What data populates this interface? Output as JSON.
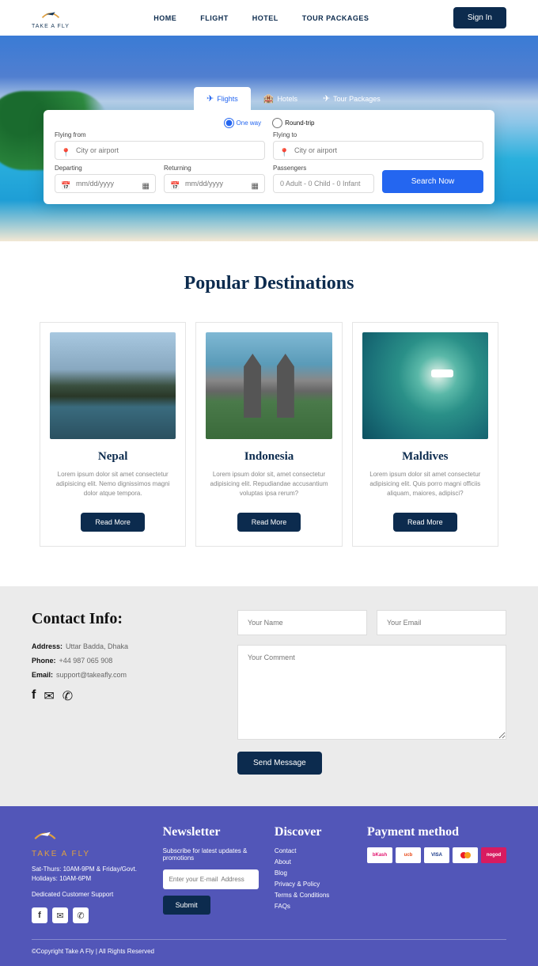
{
  "brand": "TAKE A FLY",
  "nav": {
    "home": "HOME",
    "flight": "FLIGHT",
    "hotel": "HOTEL",
    "tours": "TOUR PACKAGES"
  },
  "signin": "Sign In",
  "tabs": {
    "flights": "Flights",
    "hotels": "Hotels",
    "tours": "Tour Packages"
  },
  "trip": {
    "oneway": "One way",
    "roundtrip": "Round-trip"
  },
  "search": {
    "from_label": "Flying from",
    "to_label": "Flying to",
    "city_ph": "City or airport",
    "depart_label": "Departing",
    "return_label": "Returning",
    "date_ph": "mm/dd/yyyy",
    "pax_label": "Passengers",
    "pax_value": "0 Adult - 0 Child - 0 Infant",
    "button": "Search Now"
  },
  "popular": {
    "title": "Popular Destinations",
    "cards": [
      {
        "title": "Nepal",
        "text": "Lorem ipsum dolor sit amet consectetur adipisicing elit. Nemo dignissimos magni dolor atque tempora.",
        "btn": "Read More"
      },
      {
        "title": "Indonesia",
        "text": "Lorem ipsum dolor sit, amet consectetur adipisicing elit. Repudiandae accusantium voluptas ipsa rerum?",
        "btn": "Read More"
      },
      {
        "title": "Maldives",
        "text": "Lorem ipsum dolor sit amet consectetur adipisicing elit. Quis porro magni officiis aliquam, maiores, adipisci?",
        "btn": "Read More"
      }
    ]
  },
  "contact": {
    "title": "Contact Info:",
    "addr_label": "Address:",
    "addr": "Uttar Badda, Dhaka",
    "phone_label": "Phone:",
    "phone": "+44 987 065 908",
    "email_label": "Email:",
    "email": "support@takeafly.com",
    "name_ph": "Your Name",
    "email_ph": "Your Email",
    "comment_ph": "Your Comment",
    "send": "Send Message"
  },
  "footer": {
    "brand": "TAKE A FLY",
    "info1": "Sat-Thurs: 10AM-9PM & Friday/Govt. Holidays: 10AM-6PM",
    "info2": "Dedicated Customer Support",
    "newsletter_title": "Newsletter",
    "newsletter_sub": "Subscribe for latest updates & promotions",
    "newsletter_ph": "Enter your E-mail  Address",
    "submit": "Submit",
    "discover_title": "Discover",
    "links": [
      "Contact",
      "About",
      "Blog",
      "Privacy & Policy",
      "Terms & Conditions",
      "FAQs"
    ],
    "payment_title": "Payment method",
    "payments": [
      "bKash",
      "ucb",
      "VISA",
      "MC",
      "nogod"
    ],
    "copyright": "©Copyright Take A Fly | All Rights Reserved"
  }
}
